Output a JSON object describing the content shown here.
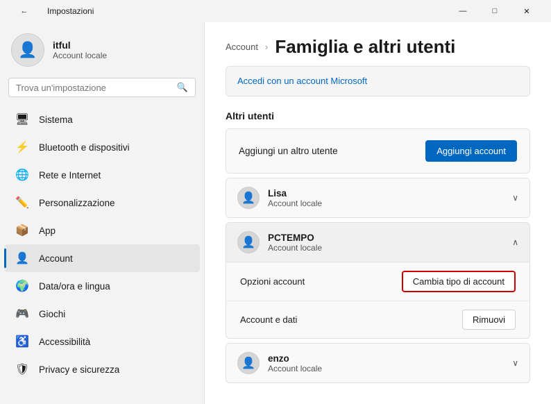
{
  "titlebar": {
    "back_icon": "←",
    "title": "Impostazioni",
    "minimize_icon": "—",
    "maximize_icon": "□",
    "close_icon": "✕"
  },
  "sidebar": {
    "user": {
      "name": "itful",
      "account_type": "Account locale"
    },
    "search": {
      "placeholder": "Trova un'impostazione"
    },
    "nav_items": [
      {
        "id": "sistema",
        "label": "Sistema",
        "icon": "🖥",
        "active": false
      },
      {
        "id": "bluetooth",
        "label": "Bluetooth e dispositivi",
        "icon": "⚡",
        "active": false
      },
      {
        "id": "rete",
        "label": "Rete e Internet",
        "icon": "🌐",
        "active": false
      },
      {
        "id": "personalizzazione",
        "label": "Personalizzazione",
        "icon": "✏️",
        "active": false
      },
      {
        "id": "app",
        "label": "App",
        "icon": "📦",
        "active": false
      },
      {
        "id": "account",
        "label": "Account",
        "icon": "👤",
        "active": true
      },
      {
        "id": "data",
        "label": "Data/ora e lingua",
        "icon": "🌍",
        "active": false
      },
      {
        "id": "giochi",
        "label": "Giochi",
        "icon": "🎮",
        "active": false
      },
      {
        "id": "accessibilita",
        "label": "Accessibilità",
        "icon": "♿",
        "active": false
      },
      {
        "id": "privacy",
        "label": "Privacy e sicurezza",
        "icon": "🛡",
        "active": false
      }
    ]
  },
  "content": {
    "breadcrumb": "Account",
    "title": "Famiglia e altri utenti",
    "microsoft_link_text": "Accedi con un account Microsoft",
    "altri_utenti_label": "Altri utenti",
    "add_user_label": "Aggiungi un altro utente",
    "add_account_btn": "Aggiungi account",
    "users": [
      {
        "id": "lisa",
        "name": "Lisa",
        "account_type": "Account locale",
        "expanded": false
      },
      {
        "id": "pctempo",
        "name": "PCTEMPO",
        "account_type": "Account locale",
        "expanded": true,
        "options": [
          {
            "label": "Opzioni account",
            "btn_label": "Cambia tipo di account",
            "btn_highlighted": true
          },
          {
            "label": "Account e dati",
            "btn_label": "Rimuovi",
            "btn_highlighted": false
          }
        ]
      },
      {
        "id": "enzo",
        "name": "enzo",
        "account_type": "Account locale",
        "expanded": false
      }
    ]
  }
}
